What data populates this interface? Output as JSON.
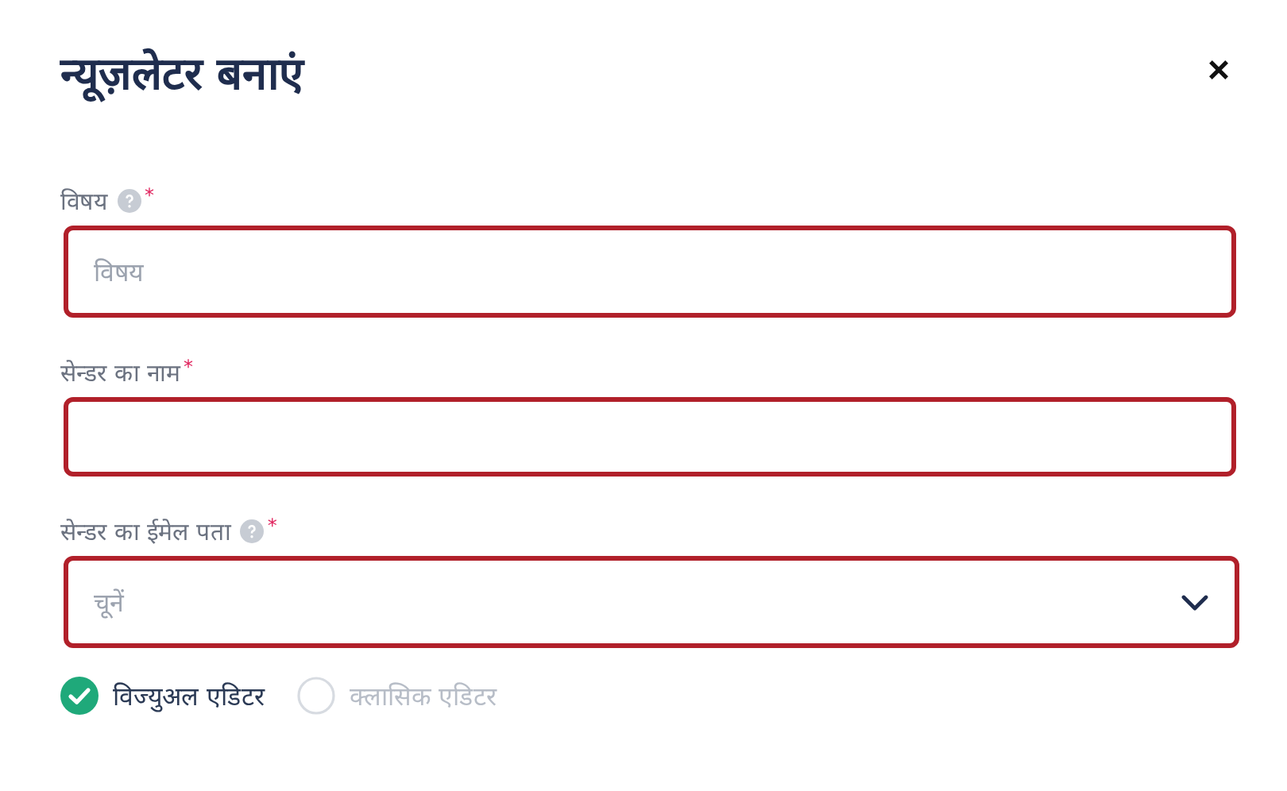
{
  "dialog": {
    "title": "न्यूज़लेटर बनाएं",
    "close": "×"
  },
  "fields": [
    {
      "kind": "text",
      "label": "विषय",
      "help": true,
      "required_mark": "*",
      "placeholder": "विषय",
      "invalid": true
    },
    {
      "kind": "text",
      "label": "सेन्डर का नाम",
      "help": false,
      "required_mark": "*",
      "invalid": true
    },
    {
      "kind": "select",
      "label": "सेन्डर का ईमेल पता",
      "help": true,
      "required_mark": "*",
      "placeholder": "चूनें",
      "invalid": true
    }
  ],
  "editor_options": [
    {
      "label": "विज्युअल एडिटर",
      "selected": true
    },
    {
      "label": "क्लासिक एडिटर",
      "selected": false
    }
  ]
}
